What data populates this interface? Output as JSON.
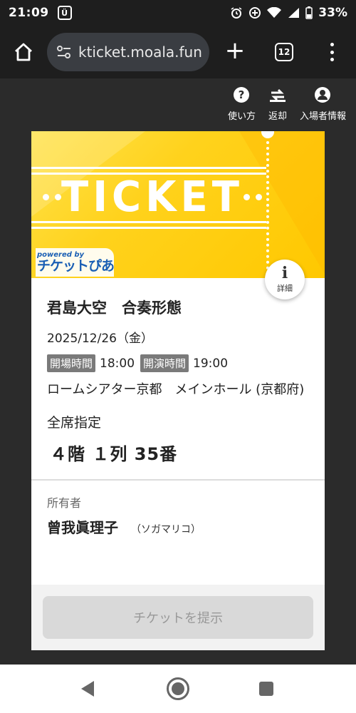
{
  "status_bar": {
    "time": "21:09",
    "notification_glyph": "Ü",
    "battery": "33%",
    "icons": [
      "alarm-icon",
      "data-saver-icon",
      "wifi-icon",
      "signal-icon",
      "battery-icon"
    ]
  },
  "browser": {
    "url": "kticket.moala.fun",
    "tab_count": "12",
    "new_tab_label": "+"
  },
  "top_actions": [
    {
      "label": "使い方",
      "icon": "help-icon"
    },
    {
      "label": "返却",
      "icon": "return-icon"
    },
    {
      "label": "入場者情報",
      "icon": "account-icon"
    }
  ],
  "ticket": {
    "banner_word": "TICKET",
    "logo_powered": "powered by",
    "logo_brand": "チケットぴあ",
    "detail_label": "詳細",
    "detail_glyph": "i",
    "event_title": "君島大空　合奏形態",
    "date": "2025/12/26（金）",
    "open_label": "開場時間",
    "open_time": "18:00",
    "start_label": "開演時間",
    "start_time": "19:00",
    "venue": "ロームシアター京都　メインホール (京都府)",
    "seat_type": "全席指定",
    "seat": "４階 １列 35番",
    "owner_label": "所有者",
    "owner_name": "曾我眞理子",
    "owner_kana": "（ソガマリコ）",
    "present_button": "チケットを提示"
  },
  "colors": {
    "banner_yellow": "#ffd21c",
    "browser_bg": "#1e1e1e",
    "tag_gray": "#7a7a7a",
    "brand_blue": "#1a5fb4"
  }
}
